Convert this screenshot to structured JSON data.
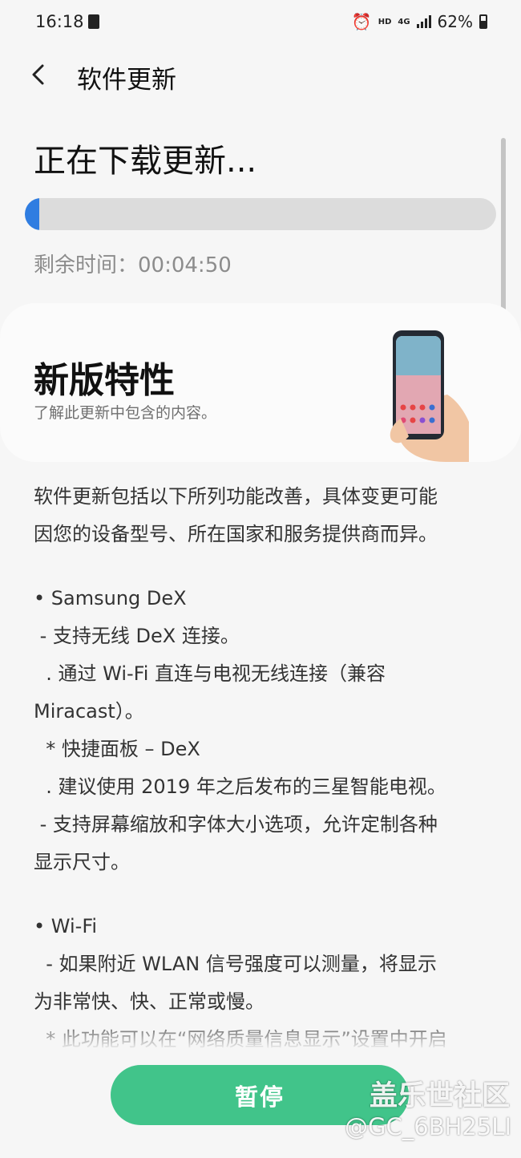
{
  "status_bar": {
    "time": "16:18",
    "hd": "HD",
    "network": "4G",
    "battery": "62%"
  },
  "header": {
    "title": "软件更新"
  },
  "download": {
    "title": "正在下载更新...",
    "progress": 0.03,
    "remaining_label": "剩余时间：00:04:50"
  },
  "features": {
    "title": "新版特性",
    "subtitle": "了解此更新中包含的内容。"
  },
  "description": {
    "lines": [
      "软件更新包括以下所列功能改善，具体变更可能",
      "因您的设备型号、所在国家和服务提供商而异。",
      "",
      "• Samsung DeX",
      " - 支持无线 DeX 连接。",
      "  . 通过 Wi-Fi 直连与电视无线连接（兼容",
      "Miracast）。",
      "  * 快捷面板 – DeX",
      "  . 建议使用 2019 年之后发布的三星智能电视。",
      " - 支持屏幕缩放和字体大小选项，允许定制各种",
      "显示尺寸。",
      "",
      "• Wi-Fi",
      "  - 如果附近 WLAN 信号强度可以测量，将显示",
      "为非常快、快、正常或慢。",
      "  * 此功能可以在“网络质量信息显示”设置中开启"
    ]
  },
  "actions": {
    "pause_label": "暂停"
  },
  "watermark": {
    "line1": "盖乐世社区",
    "line2": "@GC_6BH25LI"
  },
  "colors": {
    "accent_blue": "#2f7de1",
    "button_green": "#41c48a"
  }
}
